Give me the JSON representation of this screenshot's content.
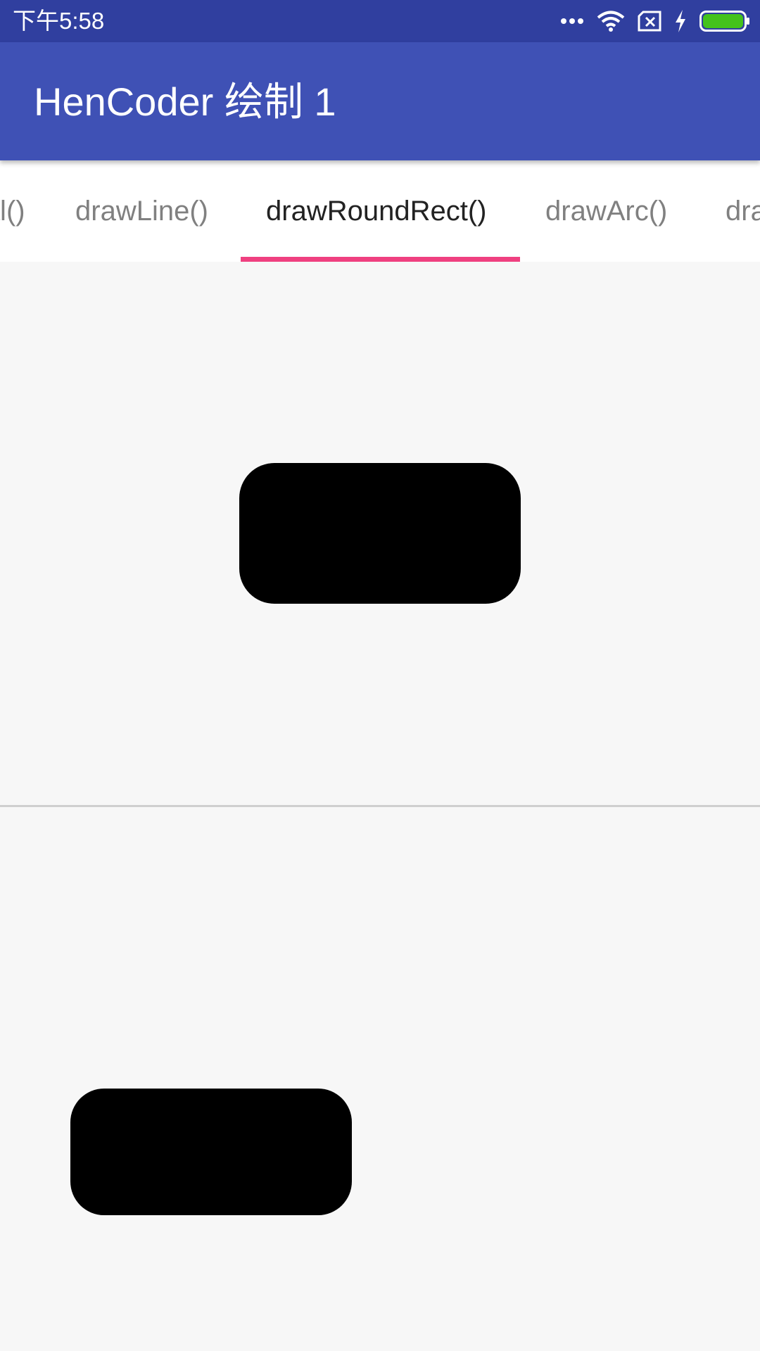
{
  "status_bar": {
    "time": "下午5:58",
    "icons": [
      "more-dots-icon",
      "wifi-icon",
      "no-sim-icon",
      "charging-bolt-icon",
      "battery-icon"
    ],
    "background": "#303f9f",
    "battery_color": "#44c21c"
  },
  "app_bar": {
    "title": "HenCoder 绘制 1",
    "background": "#3f51b5"
  },
  "tabs": {
    "items": [
      {
        "label": "drawOval()"
      },
      {
        "label": "drawLine()"
      },
      {
        "label": "drawRoundRect()",
        "selected": true
      },
      {
        "label": "drawArc()"
      },
      {
        "label": "drawPath()"
      }
    ],
    "indicator_color": "#ef4080"
  },
  "content": {
    "panels": [
      {
        "shape": "round-rect",
        "color": "#000000"
      },
      {
        "shape": "round-rect",
        "color": "#000000"
      }
    ],
    "background": "#f7f7f7"
  }
}
